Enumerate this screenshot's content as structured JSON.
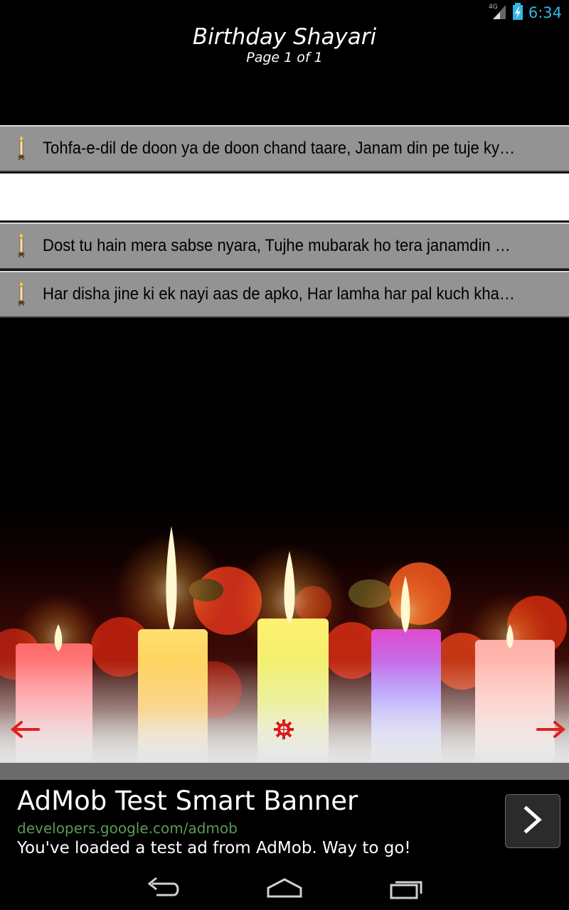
{
  "status_bar": {
    "network": "4G",
    "time": "6:34",
    "icons": [
      "signal-icon",
      "battery-charging-icon"
    ]
  },
  "header": {
    "title": "Birthday Shayari",
    "page_indicator": "Page 1 of 1"
  },
  "list": {
    "items": [
      {
        "icon": "candle-icon",
        "text": "Tohfa-e-dil de doon ya de doon chand taare, Janam din pe tuje kya du..."
      },
      {
        "icon": "candle-icon",
        "text": "Dost tu hain mera sabse nyara, Tujhe mubarak ho tera janamdin yaara..."
      },
      {
        "icon": "candle-icon",
        "text": "Har disha jine ki ek nayi aas de apko, Har lamha har pal kuch khaas de..."
      }
    ]
  },
  "controls": {
    "prev_icon": "arrow-left-icon",
    "settings_icon": "gear-icon",
    "next_icon": "arrow-right-icon",
    "arrow_color": "#e0201c"
  },
  "ad": {
    "title": "AdMob Test Smart Banner",
    "url": "developers.google.com/admob",
    "description": "You've loaded a test ad from AdMob. Way to go!",
    "button_icon": "chevron-right-icon"
  },
  "nav_bar": {
    "buttons": [
      "back-icon",
      "home-icon",
      "recent-apps-icon"
    ]
  },
  "colors": {
    "row_background": "#939393",
    "status_accent": "#33b5e5",
    "ad_url": "#5a9a55"
  }
}
